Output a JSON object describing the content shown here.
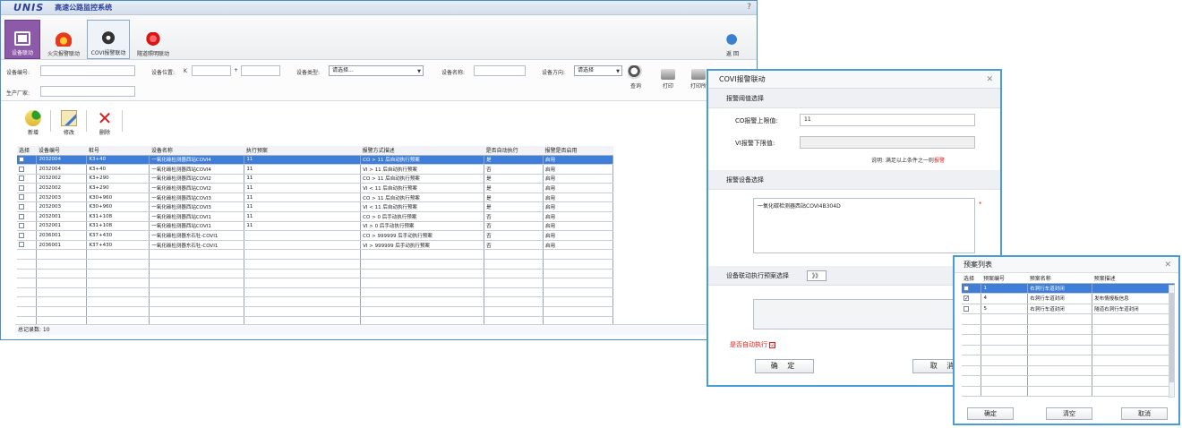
{
  "app": {
    "brand": "UNIS",
    "title": "高速公路监控系统",
    "help": "?"
  },
  "toolbar": {
    "items": [
      {
        "label": "设备联动"
      },
      {
        "label": "火灾报警联动"
      },
      {
        "label": "COVI报警联动"
      },
      {
        "label": "隧道照明联动"
      }
    ],
    "back": "返 回"
  },
  "filter": {
    "device_no": "设备编号:",
    "position": "设备位置:",
    "k": "K",
    "plus": "+",
    "type": "设备类型:",
    "type_value": "请选择...",
    "name": "设备名称:",
    "direction": "设备方向:",
    "direction_value": "请选择",
    "vendor": "生产厂家:",
    "query": "查询",
    "print": "打印",
    "print_all": "打印所"
  },
  "ops": {
    "add": "新增",
    "edit": "修改",
    "del": "删除"
  },
  "grid": {
    "columns": [
      "选择",
      "设备编号",
      "桩号",
      "设备名称",
      "执行预案",
      "报警方式描述",
      "是否自动执行",
      "报警是否启用"
    ],
    "rows": [
      [
        "2032004",
        "K3+40",
        "一氧化碳检测器西站COVI4",
        "11",
        "CO > 11 后自动执行预案",
        "是",
        "启用"
      ],
      [
        "2032004",
        "K3+40",
        "一氧化碳检测器西站COVI4",
        "11",
        "VI > 11 后自动执行预案",
        "否",
        "启用"
      ],
      [
        "2032002",
        "K3+290",
        "一氧化碳检测器西站COVI2",
        "11",
        "CO > 11 后自动执行预案",
        "是",
        "启用"
      ],
      [
        "2032002",
        "K3+290",
        "一氧化碳检测器西站COVI2",
        "11",
        "VI < 11 后自动执行预案",
        "是",
        "启用"
      ],
      [
        "2032003",
        "K30+960",
        "一氧化碳检测器西站COVI3",
        "11",
        "CO > 11 后自动执行预案",
        "是",
        "启用"
      ],
      [
        "2032003",
        "K30+960",
        "一氧化碳检测器西站COVI3",
        "11",
        "VI < 11 后自动执行预案",
        "是",
        "启用"
      ],
      [
        "2032001",
        "K31+108",
        "一氧化碳检测器西站COVI1",
        "11",
        "CO > 0 后手动执行预案",
        "否",
        "启用"
      ],
      [
        "2032001",
        "K31+108",
        "一氧化碳检测器西站COVI1",
        "11",
        "VI > 0 后手动执行预案",
        "否",
        "启用"
      ],
      [
        "2036001",
        "K37+430",
        "一氧化碳检测器东石牡-COVI1",
        "",
        "CO > 999999 后手动执行预案",
        "否",
        "启用"
      ],
      [
        "2036001",
        "K37+430",
        "一氧化碳检测器东石牡-COVI1",
        "",
        "VI > 999999 后手动执行预案",
        "否",
        "启用"
      ]
    ],
    "selected_row": 0
  },
  "footer": {
    "total": "总记录数: 10"
  },
  "covi": {
    "title": "COVI报警联动",
    "sec_threshold": "报警阈值选择",
    "co_label": "CO报警上限值:",
    "co_value": "11",
    "vi_label": "VI报警下限值:",
    "note_pre": "说明: 满足以上条件之一则",
    "note_red": "报警",
    "sec_device": "报警设备选择",
    "device_value": "一氧化碳检测器西站COVI4B304D",
    "star": "*",
    "plan_label": "设备联动执行预案选择",
    "expand": "》》",
    "auto": "是否自动执行",
    "auto_check": "☑",
    "ok": "确 定",
    "cancel": "取 消"
  },
  "plan": {
    "title": "预案列表",
    "columns": [
      "选择",
      "预案编号",
      "预案名称",
      "预案描述"
    ],
    "rows": [
      {
        "no": "1",
        "name": "右洞行车道封闭",
        "desc": "",
        "checked": false,
        "hl": true
      },
      {
        "no": "4",
        "name": "右洞行车道封闭",
        "desc": "发布情报板信息",
        "checked": true,
        "hl": false
      },
      {
        "no": "5",
        "name": "右洞行车道封闭",
        "desc": "隧道右洞行车道封闭",
        "checked": false,
        "hl": false
      }
    ],
    "ok": "确定",
    "clear": "清空",
    "cancel": "取消"
  },
  "colors": {
    "accent": "#4a9cd8",
    "highlight": "#3f7ed8",
    "active_tab": "#8c5aa8",
    "warn": "#e02020"
  },
  "icons": [
    "device-link-icon",
    "fire-icon",
    "covi-sensor-icon",
    "tunnel-light-icon",
    "back-icon",
    "search-icon",
    "print-icon",
    "add-icon",
    "edit-icon",
    "delete-icon"
  ]
}
